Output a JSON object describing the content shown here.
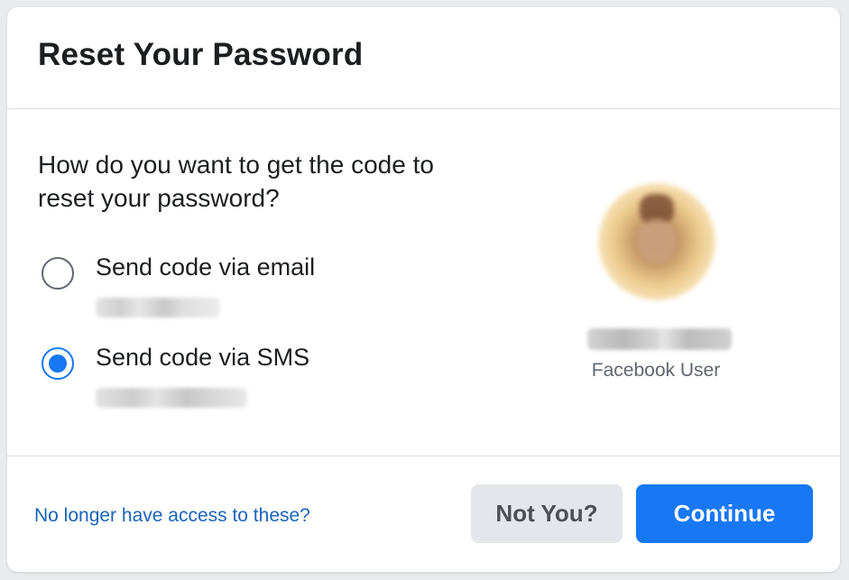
{
  "dialog": {
    "title": "Reset Your Password",
    "question": "How do you want to get the code to reset your password?"
  },
  "options": {
    "email": {
      "label": "Send code via email",
      "selected": false
    },
    "sms": {
      "label": "Send code via SMS",
      "selected": true
    }
  },
  "user": {
    "subtitle": "Facebook User"
  },
  "footer": {
    "no_access_link": "No longer have access to these?",
    "not_you_label": "Not You?",
    "continue_label": "Continue"
  },
  "colors": {
    "primary": "#1877f2",
    "link": "#1a63b9",
    "text": "#1c1e21",
    "secondary_button": "#e4e6eb"
  }
}
